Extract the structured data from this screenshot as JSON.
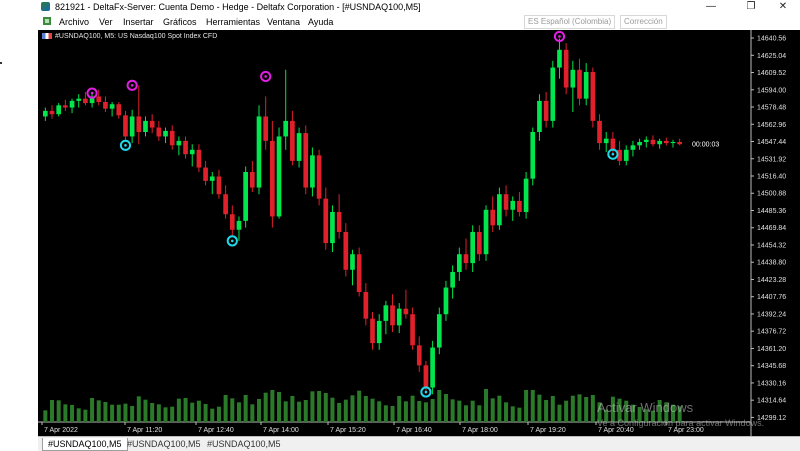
{
  "window": {
    "title": "821921 - DeltaFx-Server: Cuenta Demo - Hedge - Deltafx Corporation - [#USNDAQ100,M5]",
    "controls": [
      "—",
      "❐",
      "✕"
    ]
  },
  "menu": {
    "items": [
      "Archivo",
      "Ver",
      "Insertar",
      "Gráficos",
      "Herramientas",
      "Ventana",
      "Ayuda"
    ],
    "language": "ES Español (Colombia)",
    "correction": "Corrección"
  },
  "chart": {
    "label": "#USNDAQ100, M5:  US Nasdaq100 Spot Index CFD",
    "timer": "00:00:03"
  },
  "colors": {
    "bull": "#00e64d",
    "bear": "#e0202a",
    "magenta_marker": "#e020e0",
    "cyan_marker": "#20d8e8",
    "volume": "#2a7a2a",
    "axis_text": "#e0e0e0"
  },
  "chart_data": {
    "type": "candlestick",
    "ylim": [
      14295,
      14646
    ],
    "price_ticks": [
      "14640.56",
      "14625.04",
      "14609.52",
      "14594.00",
      "14578.48",
      "14562.96",
      "14547.44",
      "14531.92",
      "14516.40",
      "14500.88",
      "14485.36",
      "14469.84",
      "14454.32",
      "14438.80",
      "14423.28",
      "14407.76",
      "14392.24",
      "14376.72",
      "14361.20",
      "14345.68",
      "14330.16",
      "14314.64",
      "14299.12"
    ],
    "time_ticks": [
      "7 Apr 2022",
      "7 Apr 11:20",
      "7 Apr 12:40",
      "7 Apr 14:00",
      "7 Apr 15:20",
      "7 Apr 16:40",
      "7 Apr 18:00",
      "7 Apr 19:20",
      "7 Apr 20:40",
      "7 Apr 23:00"
    ],
    "candles": [
      [
        14570,
        14578,
        14566,
        14575
      ],
      [
        14575,
        14580,
        14568,
        14572
      ],
      [
        14572,
        14582,
        14570,
        14580
      ],
      [
        14580,
        14585,
        14575,
        14578
      ],
      [
        14578,
        14586,
        14573,
        14584
      ],
      [
        14584,
        14590,
        14578,
        14586
      ],
      [
        14586,
        14592,
        14580,
        14582
      ],
      [
        14582,
        14590,
        14578,
        14588
      ],
      [
        14588,
        14594,
        14580,
        14583
      ],
      [
        14583,
        14588,
        14574,
        14577
      ],
      [
        14577,
        14583,
        14570,
        14581
      ],
      [
        14581,
        14583,
        14568,
        14571
      ],
      [
        14571,
        14575,
        14548,
        14552
      ],
      [
        14552,
        14576,
        14546,
        14570
      ],
      [
        14570,
        14598,
        14545,
        14556
      ],
      [
        14556,
        14570,
        14552,
        14566
      ],
      [
        14566,
        14572,
        14555,
        14560
      ],
      [
        14560,
        14566,
        14548,
        14552
      ],
      [
        14552,
        14560,
        14546,
        14557
      ],
      [
        14557,
        14562,
        14540,
        14544
      ],
      [
        14544,
        14552,
        14535,
        14548
      ],
      [
        14548,
        14552,
        14532,
        14536
      ],
      [
        14536,
        14545,
        14525,
        14540
      ],
      [
        14540,
        14545,
        14520,
        14524
      ],
      [
        14524,
        14530,
        14508,
        14512
      ],
      [
        14512,
        14520,
        14500,
        14516
      ],
      [
        14516,
        14522,
        14496,
        14500
      ],
      [
        14500,
        14508,
        14478,
        14482
      ],
      [
        14482,
        14490,
        14463,
        14468
      ],
      [
        14468,
        14480,
        14458,
        14476
      ],
      [
        14476,
        14525,
        14470,
        14520
      ],
      [
        14520,
        14530,
        14502,
        14506
      ],
      [
        14506,
        14580,
        14500,
        14570
      ],
      [
        14570,
        14588,
        14540,
        14548
      ],
      [
        14548,
        14566,
        14470,
        14480
      ],
      [
        14480,
        14560,
        14478,
        14552
      ],
      [
        14552,
        14612,
        14540,
        14566
      ],
      [
        14566,
        14575,
        14526,
        14530
      ],
      [
        14530,
        14560,
        14524,
        14555
      ],
      [
        14555,
        14562,
        14500,
        14506
      ],
      [
        14506,
        14542,
        14498,
        14535
      ],
      [
        14535,
        14540,
        14490,
        14496
      ],
      [
        14496,
        14506,
        14450,
        14456
      ],
      [
        14456,
        14490,
        14448,
        14484
      ],
      [
        14484,
        14500,
        14460,
        14466
      ],
      [
        14466,
        14474,
        14426,
        14432
      ],
      [
        14432,
        14450,
        14418,
        14446
      ],
      [
        14446,
        14452,
        14408,
        14412
      ],
      [
        14412,
        14420,
        14382,
        14388
      ],
      [
        14388,
        14394,
        14360,
        14366
      ],
      [
        14366,
        14392,
        14360,
        14386
      ],
      [
        14386,
        14404,
        14374,
        14400
      ],
      [
        14400,
        14410,
        14376,
        14382
      ],
      [
        14382,
        14402,
        14375,
        14397
      ],
      [
        14397,
        14414,
        14388,
        14392
      ],
      [
        14392,
        14398,
        14360,
        14364
      ],
      [
        14364,
        14372,
        14340,
        14346
      ],
      [
        14346,
        14350,
        14320,
        14326
      ],
      [
        14326,
        14368,
        14320,
        14362
      ],
      [
        14362,
        14398,
        14356,
        14392
      ],
      [
        14392,
        14422,
        14386,
        14416
      ],
      [
        14416,
        14436,
        14406,
        14430
      ],
      [
        14430,
        14452,
        14422,
        14446
      ],
      [
        14446,
        14460,
        14432,
        14438
      ],
      [
        14438,
        14472,
        14430,
        14466
      ],
      [
        14466,
        14472,
        14440,
        14446
      ],
      [
        14446,
        14490,
        14440,
        14486
      ],
      [
        14486,
        14498,
        14466,
        14472
      ],
      [
        14472,
        14506,
        14468,
        14500
      ],
      [
        14500,
        14508,
        14480,
        14486
      ],
      [
        14486,
        14498,
        14476,
        14494
      ],
      [
        14494,
        14502,
        14480,
        14484
      ],
      [
        14484,
        14520,
        14478,
        14514
      ],
      [
        14514,
        14560,
        14508,
        14556
      ],
      [
        14556,
        14590,
        14548,
        14584
      ],
      [
        14584,
        14592,
        14560,
        14566
      ],
      [
        14566,
        14620,
        14560,
        14614
      ],
      [
        14614,
        14640,
        14604,
        14630
      ],
      [
        14630,
        14636,
        14590,
        14596
      ],
      [
        14596,
        14620,
        14574,
        14612
      ],
      [
        14612,
        14622,
        14580,
        14586
      ],
      [
        14586,
        14618,
        14580,
        14610
      ],
      [
        14610,
        14614,
        14560,
        14566
      ],
      [
        14566,
        14572,
        14540,
        14546
      ],
      [
        14546,
        14556,
        14538,
        14550
      ],
      [
        14550,
        14556,
        14536,
        14540
      ],
      [
        14540,
        14548,
        14526,
        14530
      ],
      [
        14530,
        14544,
        14526,
        14540
      ],
      [
        14540,
        14548,
        14534,
        14544
      ],
      [
        14544,
        14550,
        14540,
        14547
      ],
      [
        14547,
        14552,
        14542,
        14549
      ],
      [
        14549,
        14553,
        14543,
        14545
      ],
      [
        14545,
        14550,
        14541,
        14548
      ],
      [
        14548,
        14551,
        14544,
        14546
      ],
      [
        14546,
        14549,
        14542,
        14547
      ],
      [
        14547,
        14550,
        14544,
        14545
      ]
    ],
    "fractal_markers": [
      {
        "type": "high",
        "index": 7,
        "price": 14591
      },
      {
        "type": "high",
        "index": 13,
        "price": 14598
      },
      {
        "type": "low",
        "index": 12,
        "price": 14544
      },
      {
        "type": "low",
        "index": 28,
        "price": 14458
      },
      {
        "type": "high",
        "index": 33,
        "price": 14606
      },
      {
        "type": "low",
        "index": 57,
        "price": 14322
      },
      {
        "type": "high",
        "index": 77,
        "price": 14642
      },
      {
        "type": "low",
        "index": 85,
        "price": 14536
      }
    ]
  },
  "tabs": [
    "#USNDAQ100,M5",
    "#USNDAQ100,M5",
    "#USNDAQ100,M5"
  ],
  "watermark": {
    "line1": "Activar Windows",
    "line2": "Ve a Configuración para activar Windows."
  }
}
